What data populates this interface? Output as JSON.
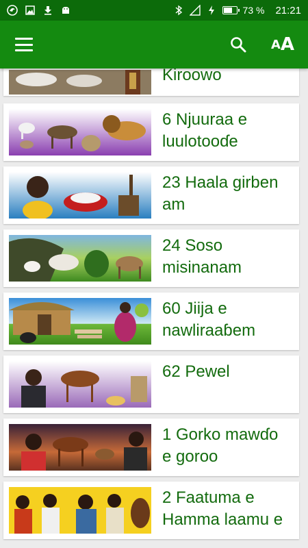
{
  "status_bar": {
    "battery_percent": "73 %",
    "battery_level": 0.73,
    "time": "21:21",
    "left_icons": [
      "app-notification-icon",
      "image-icon",
      "download-icon",
      "android-icon"
    ],
    "right_icons": [
      "bluetooth-icon",
      "signal-icon",
      "battery-icon"
    ]
  },
  "app_bar": {
    "menu_icon": "hamburger-menu-icon",
    "search_icon": "search-icon",
    "font_icon_small": "A",
    "font_icon_big": "A"
  },
  "colors": {
    "status_bar": "#0c6b0a",
    "app_bar": "#148a10",
    "title_text": "#136b0e",
    "background": "#ececec"
  },
  "list": {
    "items": [
      {
        "title": "Kiroowo"
      },
      {
        "title": "6 Njuuraa e luulotooɗe"
      },
      {
        "title": "23 Haala girben am"
      },
      {
        "title": "24 Soso misinanam"
      },
      {
        "title": "60 Jiija e nawliraaɓem"
      },
      {
        "title": "62 Pewel"
      },
      {
        "title": "1 Gorko mawɗo e goroo"
      },
      {
        "title": "2 Faatuma e Hamma laamu e"
      }
    ]
  }
}
